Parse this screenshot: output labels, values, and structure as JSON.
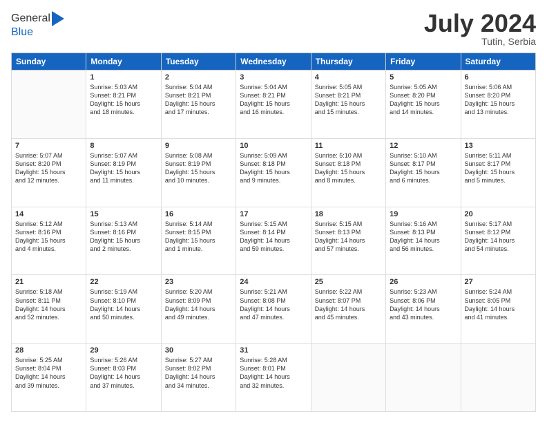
{
  "logo": {
    "general": "General",
    "blue": "Blue"
  },
  "header": {
    "month_year": "July 2024",
    "location": "Tutin, Serbia"
  },
  "weekdays": [
    "Sunday",
    "Monday",
    "Tuesday",
    "Wednesday",
    "Thursday",
    "Friday",
    "Saturday"
  ],
  "weeks": [
    [
      {
        "day": "",
        "info": ""
      },
      {
        "day": "1",
        "info": "Sunrise: 5:03 AM\nSunset: 8:21 PM\nDaylight: 15 hours\nand 18 minutes."
      },
      {
        "day": "2",
        "info": "Sunrise: 5:04 AM\nSunset: 8:21 PM\nDaylight: 15 hours\nand 17 minutes."
      },
      {
        "day": "3",
        "info": "Sunrise: 5:04 AM\nSunset: 8:21 PM\nDaylight: 15 hours\nand 16 minutes."
      },
      {
        "day": "4",
        "info": "Sunrise: 5:05 AM\nSunset: 8:21 PM\nDaylight: 15 hours\nand 15 minutes."
      },
      {
        "day": "5",
        "info": "Sunrise: 5:05 AM\nSunset: 8:20 PM\nDaylight: 15 hours\nand 14 minutes."
      },
      {
        "day": "6",
        "info": "Sunrise: 5:06 AM\nSunset: 8:20 PM\nDaylight: 15 hours\nand 13 minutes."
      }
    ],
    [
      {
        "day": "7",
        "info": "Sunrise: 5:07 AM\nSunset: 8:20 PM\nDaylight: 15 hours\nand 12 minutes."
      },
      {
        "day": "8",
        "info": "Sunrise: 5:07 AM\nSunset: 8:19 PM\nDaylight: 15 hours\nand 11 minutes."
      },
      {
        "day": "9",
        "info": "Sunrise: 5:08 AM\nSunset: 8:19 PM\nDaylight: 15 hours\nand 10 minutes."
      },
      {
        "day": "10",
        "info": "Sunrise: 5:09 AM\nSunset: 8:18 PM\nDaylight: 15 hours\nand 9 minutes."
      },
      {
        "day": "11",
        "info": "Sunrise: 5:10 AM\nSunset: 8:18 PM\nDaylight: 15 hours\nand 8 minutes."
      },
      {
        "day": "12",
        "info": "Sunrise: 5:10 AM\nSunset: 8:17 PM\nDaylight: 15 hours\nand 6 minutes."
      },
      {
        "day": "13",
        "info": "Sunrise: 5:11 AM\nSunset: 8:17 PM\nDaylight: 15 hours\nand 5 minutes."
      }
    ],
    [
      {
        "day": "14",
        "info": "Sunrise: 5:12 AM\nSunset: 8:16 PM\nDaylight: 15 hours\nand 4 minutes."
      },
      {
        "day": "15",
        "info": "Sunrise: 5:13 AM\nSunset: 8:16 PM\nDaylight: 15 hours\nand 2 minutes."
      },
      {
        "day": "16",
        "info": "Sunrise: 5:14 AM\nSunset: 8:15 PM\nDaylight: 15 hours\nand 1 minute."
      },
      {
        "day": "17",
        "info": "Sunrise: 5:15 AM\nSunset: 8:14 PM\nDaylight: 14 hours\nand 59 minutes."
      },
      {
        "day": "18",
        "info": "Sunrise: 5:15 AM\nSunset: 8:13 PM\nDaylight: 14 hours\nand 57 minutes."
      },
      {
        "day": "19",
        "info": "Sunrise: 5:16 AM\nSunset: 8:13 PM\nDaylight: 14 hours\nand 56 minutes."
      },
      {
        "day": "20",
        "info": "Sunrise: 5:17 AM\nSunset: 8:12 PM\nDaylight: 14 hours\nand 54 minutes."
      }
    ],
    [
      {
        "day": "21",
        "info": "Sunrise: 5:18 AM\nSunset: 8:11 PM\nDaylight: 14 hours\nand 52 minutes."
      },
      {
        "day": "22",
        "info": "Sunrise: 5:19 AM\nSunset: 8:10 PM\nDaylight: 14 hours\nand 50 minutes."
      },
      {
        "day": "23",
        "info": "Sunrise: 5:20 AM\nSunset: 8:09 PM\nDaylight: 14 hours\nand 49 minutes."
      },
      {
        "day": "24",
        "info": "Sunrise: 5:21 AM\nSunset: 8:08 PM\nDaylight: 14 hours\nand 47 minutes."
      },
      {
        "day": "25",
        "info": "Sunrise: 5:22 AM\nSunset: 8:07 PM\nDaylight: 14 hours\nand 45 minutes."
      },
      {
        "day": "26",
        "info": "Sunrise: 5:23 AM\nSunset: 8:06 PM\nDaylight: 14 hours\nand 43 minutes."
      },
      {
        "day": "27",
        "info": "Sunrise: 5:24 AM\nSunset: 8:05 PM\nDaylight: 14 hours\nand 41 minutes."
      }
    ],
    [
      {
        "day": "28",
        "info": "Sunrise: 5:25 AM\nSunset: 8:04 PM\nDaylight: 14 hours\nand 39 minutes."
      },
      {
        "day": "29",
        "info": "Sunrise: 5:26 AM\nSunset: 8:03 PM\nDaylight: 14 hours\nand 37 minutes."
      },
      {
        "day": "30",
        "info": "Sunrise: 5:27 AM\nSunset: 8:02 PM\nDaylight: 14 hours\nand 34 minutes."
      },
      {
        "day": "31",
        "info": "Sunrise: 5:28 AM\nSunset: 8:01 PM\nDaylight: 14 hours\nand 32 minutes."
      },
      {
        "day": "",
        "info": ""
      },
      {
        "day": "",
        "info": ""
      },
      {
        "day": "",
        "info": ""
      }
    ]
  ]
}
